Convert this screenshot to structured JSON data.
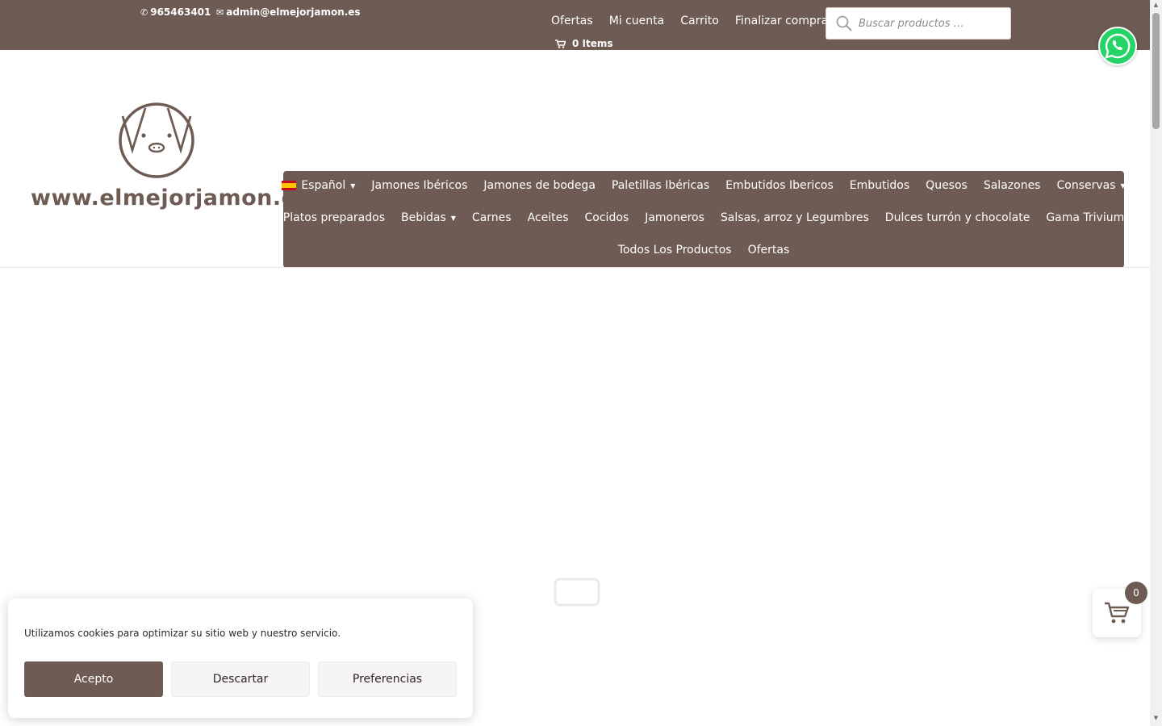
{
  "topbar": {
    "phone": "965463401",
    "email": "admin@elmejorjamon.es",
    "links": [
      "Ofertas",
      "Mi cuenta",
      "Carrito",
      "Finalizar compra"
    ],
    "cart_items": "0 Items",
    "search_placeholder": "Buscar productos …"
  },
  "brand": {
    "site_name": "www.elmejorjamon.es"
  },
  "nav": {
    "language": "Español",
    "row1": [
      "Jamones Ibéricos",
      "Jamones de bodega",
      "Paletillas Ibéricas",
      "Embutidos Ibericos",
      "Embutidos",
      "Quesos",
      "Salazones",
      "Conservas"
    ],
    "row2": [
      "Platos preparados",
      "Bebidas",
      "Carnes",
      "Aceites",
      "Cocidos",
      "Jamoneros",
      "Salsas, arroz y Legumbres",
      "Dulces turrón y chocolate",
      "Gama Trivium"
    ],
    "row3": [
      "Todos Los Productos",
      "Ofertas"
    ]
  },
  "cookie": {
    "message": "Utilizamos cookies para optimizar su sitio web y nuestro servicio.",
    "accept": "Acepto",
    "deny": "Descartar",
    "preferences": "Preferencias"
  },
  "floating_cart": {
    "count": "0"
  },
  "colors": {
    "brand": "#6e5b53",
    "whatsapp": "#25d366"
  }
}
